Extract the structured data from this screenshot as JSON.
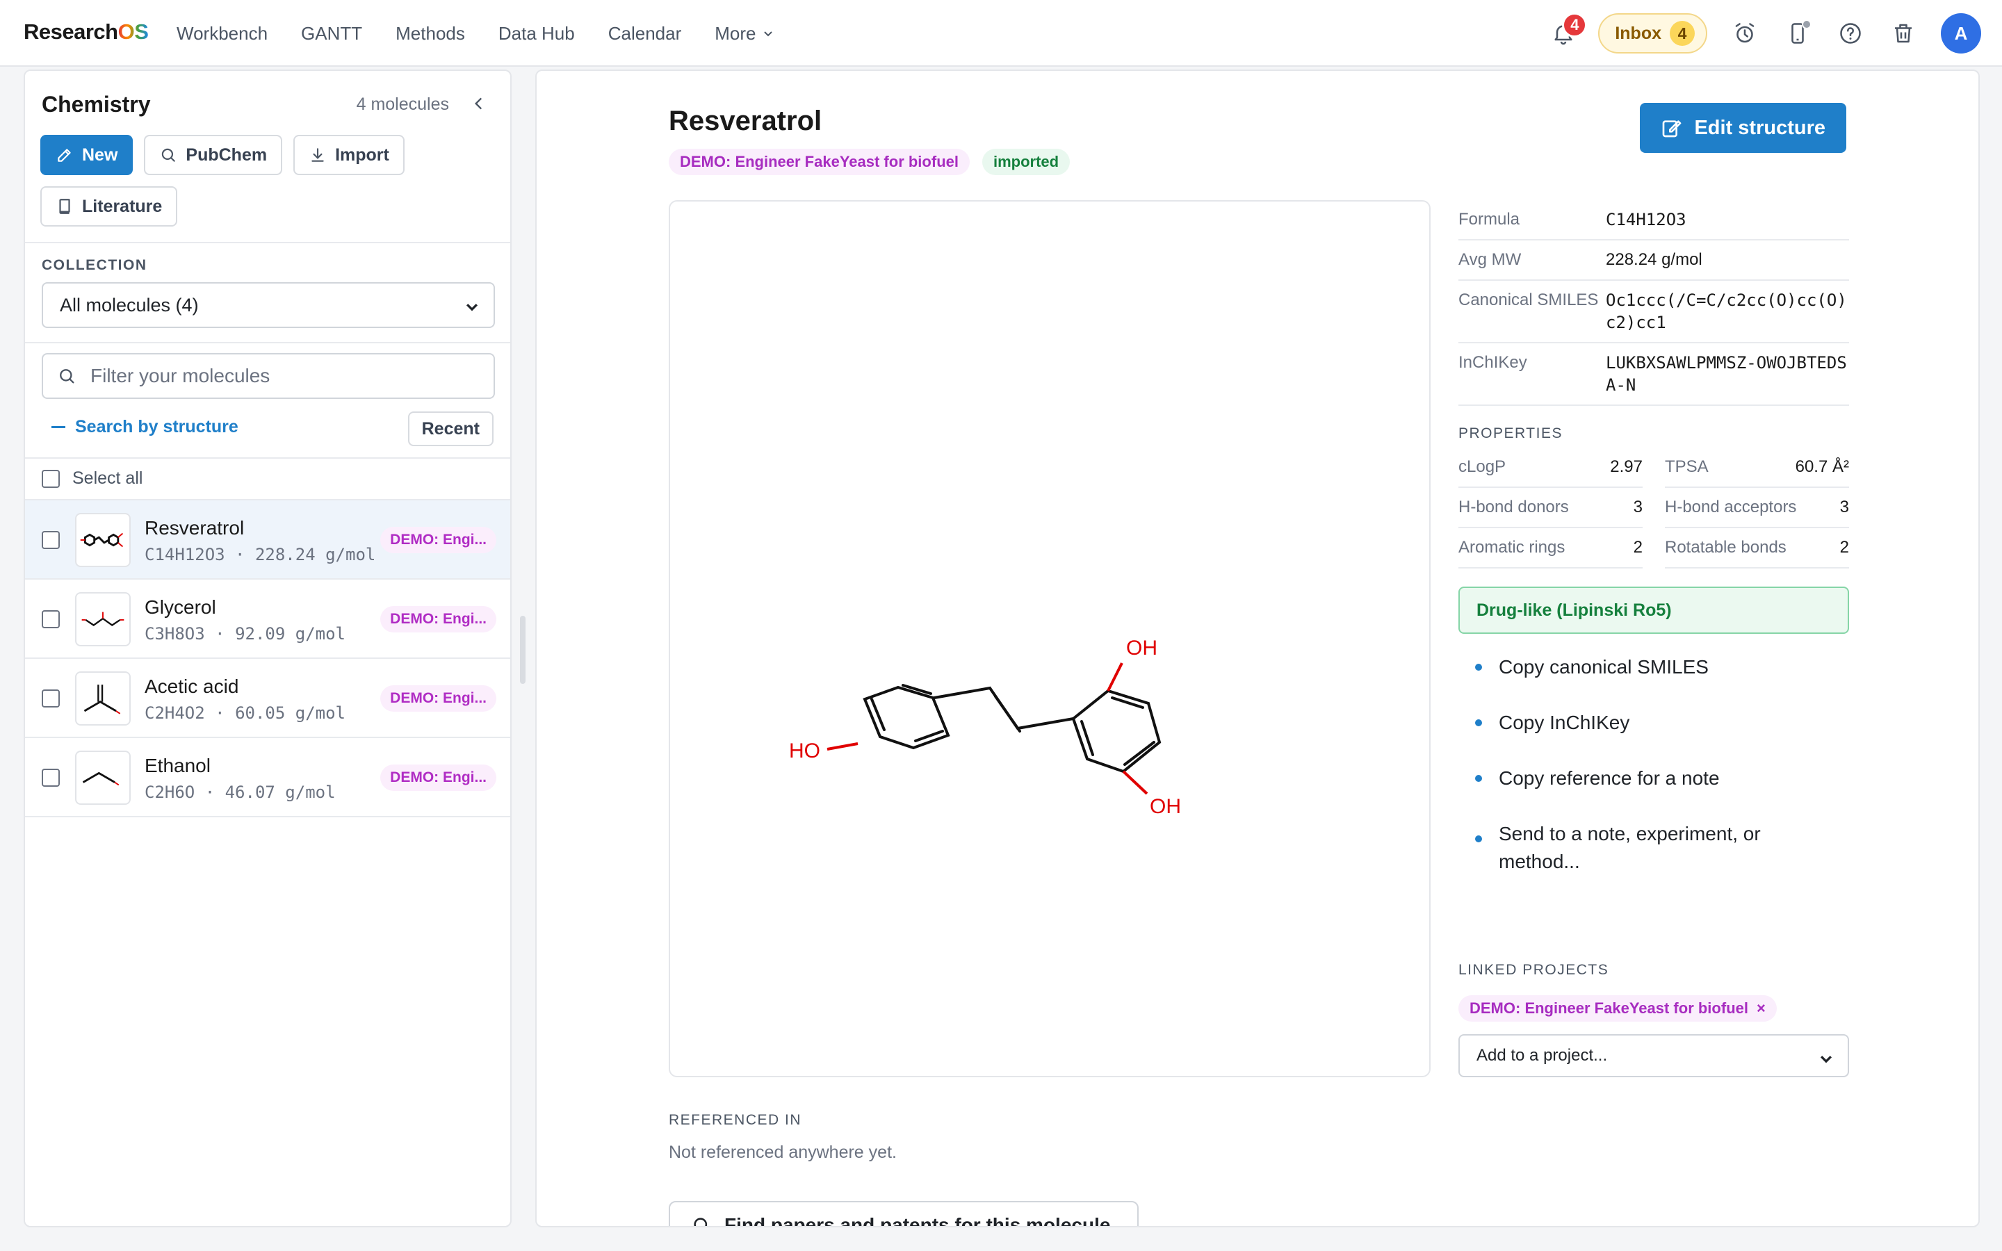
{
  "nav": {
    "brand_main": "Research",
    "brand_accent": "OS",
    "links": [
      "Workbench",
      "GANTT",
      "Methods",
      "Data Hub",
      "Calendar"
    ],
    "more_label": "More",
    "notifications_count": "4",
    "inbox_label": "Inbox",
    "inbox_count": "4",
    "avatar_initial": "A"
  },
  "sidebar": {
    "title": "Chemistry",
    "count": "4 molecules",
    "buttons": {
      "new": "New",
      "pubchem": "PubChem",
      "import": "Import",
      "literature": "Literature"
    },
    "collection_label": "COLLECTION",
    "collection_value": "All molecules (4)",
    "filter_placeholder": "Filter your molecules",
    "search_by_structure": "Search by structure",
    "recent_label": "Recent",
    "select_all": "Select all",
    "molecules": [
      {
        "name": "Resveratrol",
        "formula": "C14H12O3",
        "mw": "228.24 g/mol",
        "tag": "DEMO: Engi..."
      },
      {
        "name": "Glycerol",
        "formula": "C3H8O3",
        "mw": "92.09 g/mol",
        "tag": "DEMO: Engi..."
      },
      {
        "name": "Acetic acid",
        "formula": "C2H4O2",
        "mw": "60.05 g/mol",
        "tag": "DEMO: Engi..."
      },
      {
        "name": "Ethanol",
        "formula": "C2H6O",
        "mw": "46.07 g/mol",
        "tag": "DEMO: Engi..."
      }
    ],
    "meta_separator": "·"
  },
  "detail": {
    "title": "Resveratrol",
    "project_pill": "DEMO: Engineer FakeYeast for biofuel",
    "status_pill": "imported",
    "edit_label": "Edit structure",
    "atom_labels": {
      "ho_left": "HO",
      "oh_top": "OH",
      "oh_bottom": "OH"
    },
    "formula_label": "Formula",
    "formula_value": "C14H12O3",
    "mw_label": "Avg MW",
    "mw_value": "228.24 g/mol",
    "smiles_label": "Canonical SMILES",
    "smiles_value": "Oc1ccc(/C=C/c2cc(O)cc(O)c2)cc1",
    "inchikey_label": "InChIKey",
    "inchikey_value": "LUKBXSAWLPMMSZ-OWOJBTEDSA-N",
    "properties_label": "PROPERTIES",
    "properties": [
      {
        "k": "cLogP",
        "v": "2.97"
      },
      {
        "k": "TPSA",
        "v": "60.7 Å²"
      },
      {
        "k": "H-bond donors",
        "v": "3"
      },
      {
        "k": "H-bond acceptors",
        "v": "3"
      },
      {
        "k": "Aromatic rings",
        "v": "2"
      },
      {
        "k": "Rotatable bonds",
        "v": "2"
      }
    ],
    "druglike_label": "Drug-like (Lipinski Ro5)",
    "actions": [
      "Copy canonical SMILES",
      "Copy InChIKey",
      "Copy reference for a note",
      "Send to a note, experiment, or method..."
    ],
    "linked_projects_label": "LINKED PROJECTS",
    "linked_project": "DEMO: Engineer FakeYeast for biofuel",
    "linked_remove": "×",
    "add_project_value": "Add to a project...",
    "referenced_label": "REFERENCED IN",
    "referenced_value": "Not referenced anywhere yet.",
    "find_papers_label": "Find papers and patents for this molecule"
  },
  "colors": {
    "primary": "#1f7fc9",
    "tag_purple": "#b02cc4",
    "success": "#15803d",
    "danger": "#e5383b",
    "oxygen": "#e00000"
  }
}
